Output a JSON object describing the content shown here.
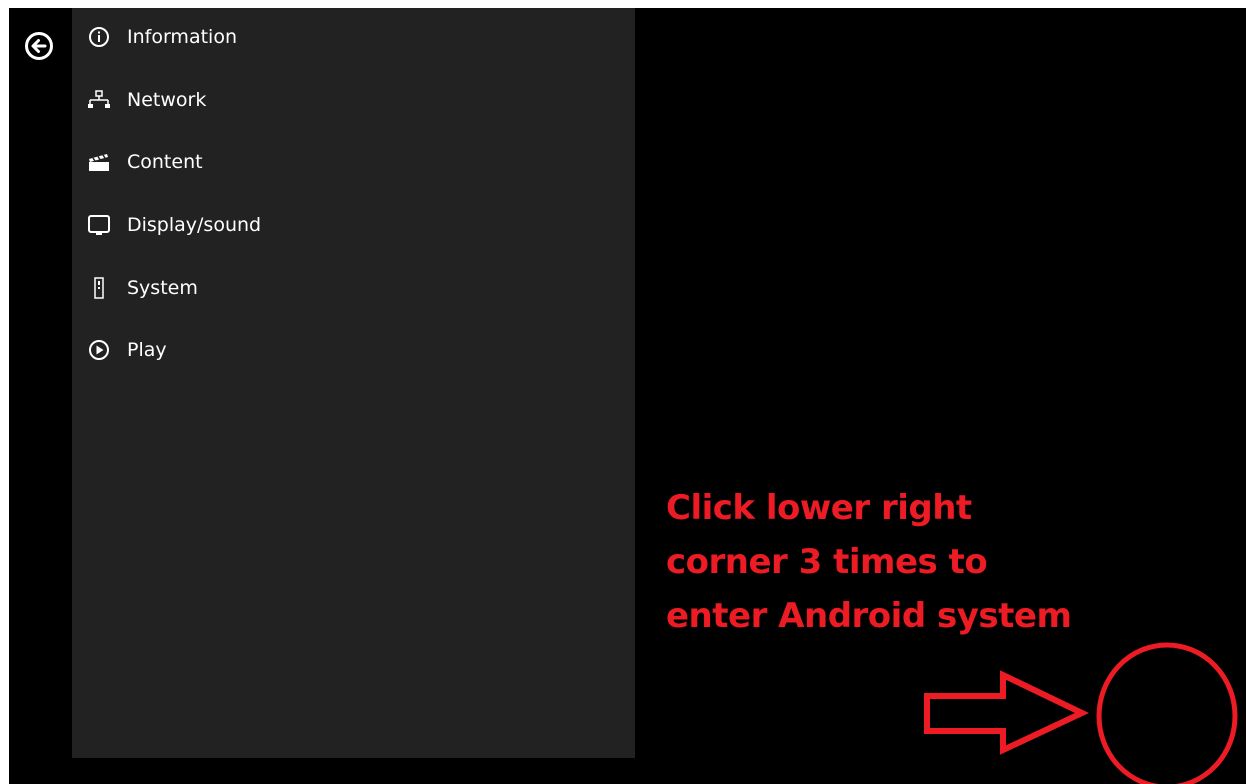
{
  "header": {
    "back_icon": "arrow-left-circle-icon"
  },
  "menu": {
    "items": [
      {
        "label": "Information",
        "icon": "info-icon"
      },
      {
        "label": "Network",
        "icon": "network-icon"
      },
      {
        "label": "Content",
        "icon": "clapperboard-icon"
      },
      {
        "label": "Display/sound",
        "icon": "monitor-icon"
      },
      {
        "label": "System",
        "icon": "device-icon"
      },
      {
        "label": "Play",
        "icon": "play-circle-icon"
      }
    ]
  },
  "annotation": {
    "lines": [
      "Click lower right",
      "corner 3 times to",
      "enter Android system"
    ],
    "color": "#ed1c24",
    "shapes": [
      "arrow-right-outline",
      "circle-outline"
    ]
  },
  "colors": {
    "screen_background": "#000000",
    "panel_background": "#222222",
    "text": "#ffffff",
    "annotation": "#ed1c24"
  }
}
